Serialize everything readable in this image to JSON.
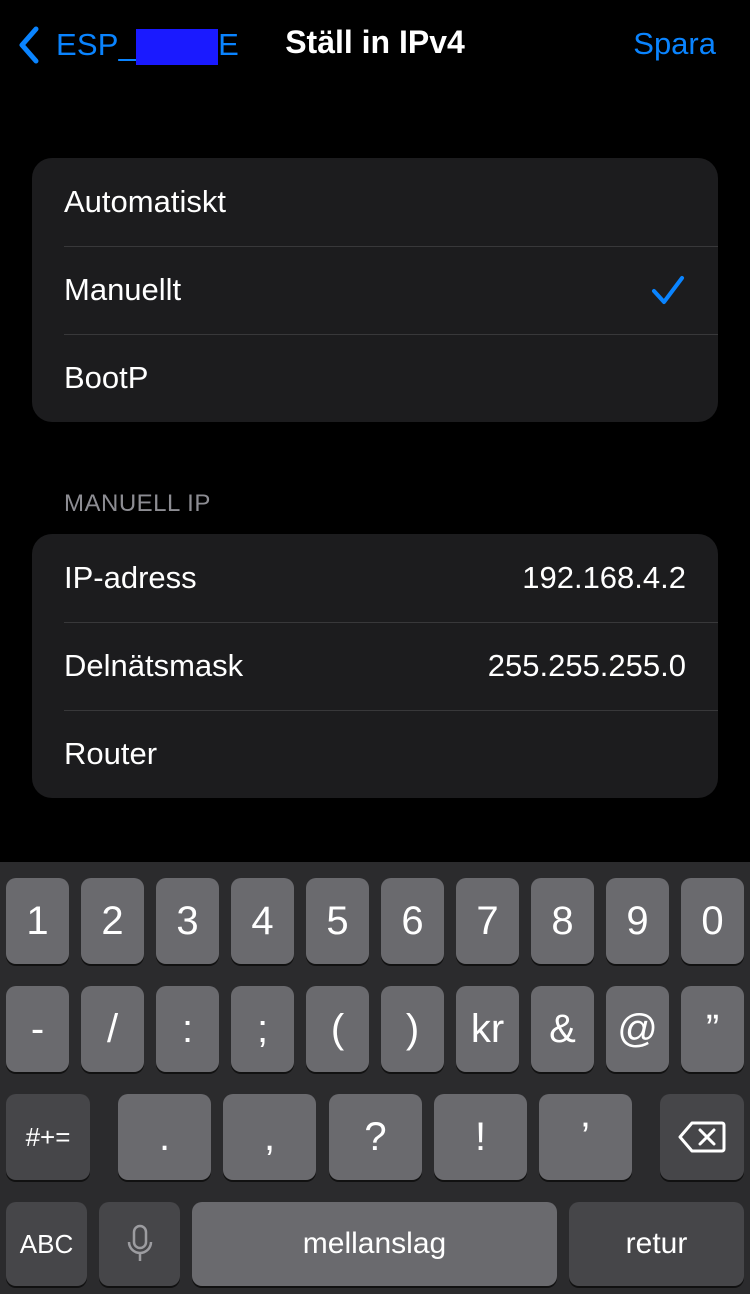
{
  "nav": {
    "back_label": "ESP_",
    "back_label_suffix": "E",
    "title": "Ställ in IPv4",
    "save_label": "Spara"
  },
  "config_options": [
    {
      "label": "Automatiskt",
      "selected": false
    },
    {
      "label": "Manuellt",
      "selected": true
    },
    {
      "label": "BootP",
      "selected": false
    }
  ],
  "manual_ip": {
    "header": "MANUELL IP",
    "rows": [
      {
        "label": "IP-adress",
        "value": "192.168.4.2"
      },
      {
        "label": "Delnätsmask",
        "value": "255.255.255.0"
      },
      {
        "label": "Router",
        "value": ""
      }
    ]
  },
  "keyboard": {
    "row1": [
      "1",
      "2",
      "3",
      "4",
      "5",
      "6",
      "7",
      "8",
      "9",
      "0"
    ],
    "row2": [
      "-",
      "/",
      ":",
      ";",
      "(",
      ")",
      "kr",
      "&",
      "@",
      "”"
    ],
    "row3": {
      "shift": "#+=",
      "keys": [
        ".",
        ",",
        "?",
        "!",
        "’"
      ]
    },
    "row4": {
      "abc": "ABC",
      "space": "mellanslag",
      "return": "retur"
    }
  },
  "colors": {
    "accent": "#0a84ff",
    "background": "#000000",
    "group_bg": "#1c1c1e",
    "key_bg": "#6a6a6e",
    "key_dark_bg": "#464649",
    "keyboard_bg": "#2b2b2d"
  },
  "icons": {
    "back": "chevron-left-icon",
    "check": "checkmark-icon",
    "mic": "microphone-icon",
    "delete": "delete-backward-icon"
  }
}
